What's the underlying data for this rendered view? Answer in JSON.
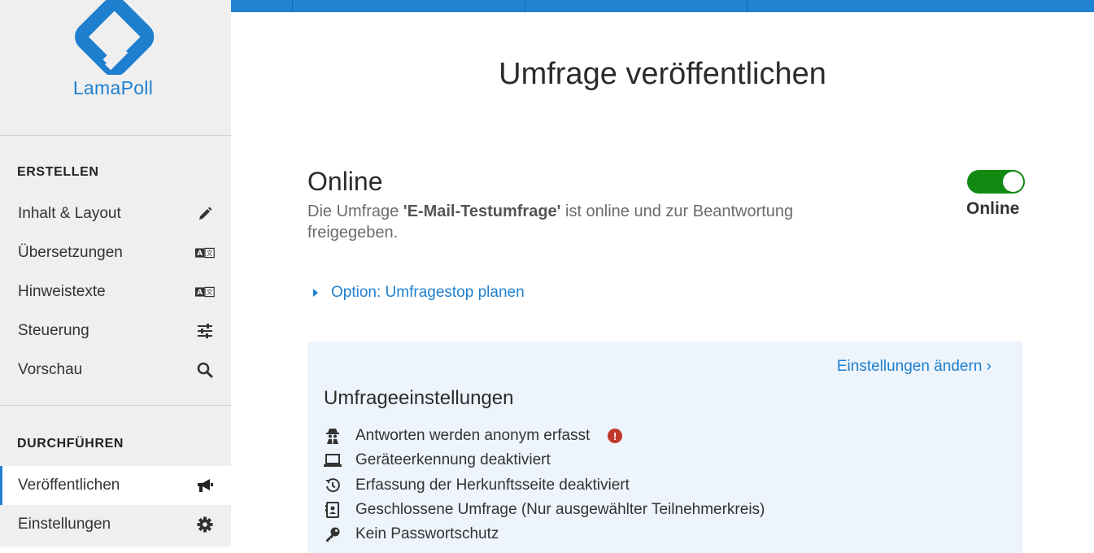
{
  "brand": {
    "name": "LamaPoll",
    "color": "#1f7fcf"
  },
  "sidebar": {
    "sections": [
      {
        "heading": "ERSTELLEN",
        "items": [
          {
            "label": "Inhalt & Layout",
            "icon": "pencil-icon"
          },
          {
            "label": "Übersetzungen",
            "icon": "translate-icon"
          },
          {
            "label": "Hinweistexte",
            "icon": "translate-icon"
          },
          {
            "label": "Steuerung",
            "icon": "sliders-icon"
          },
          {
            "label": "Vorschau",
            "icon": "search-icon"
          }
        ]
      },
      {
        "heading": "DURCHFÜHREN",
        "items": [
          {
            "label": "Veröffentlichen",
            "icon": "megaphone-icon",
            "active": true
          },
          {
            "label": "Einstellungen",
            "icon": "gear-icon"
          }
        ]
      }
    ]
  },
  "main": {
    "title": "Umfrage veröffentlichen",
    "status": {
      "heading": "Online",
      "desc_prefix": "Die Umfrage ",
      "survey_name": "'E-Mail-Testumfrage'",
      "desc_suffix": " ist online und zur Beantwortung freigegeben.",
      "toggle_on": true,
      "toggle_label": "Online",
      "toggle_color": "#128a12"
    },
    "option_link": "Option: Umfragestop planen",
    "settings": {
      "change_link": "Einstellungen ändern ›",
      "title": "Umfrageeinstellungen",
      "items": [
        {
          "text": "Antworten werden anonym erfasst",
          "icon": "spy-icon",
          "warning": true
        },
        {
          "text": "Geräteerkennung deaktiviert",
          "icon": "laptop-icon"
        },
        {
          "text": "Erfassung der Herkunftsseite deaktiviert",
          "icon": "history-icon"
        },
        {
          "text": "Geschlossene Umfrage (Nur ausgewählter Teilnehmerkreis)",
          "icon": "contact-card-icon"
        },
        {
          "text": "Kein Passwortschutz",
          "icon": "key-icon"
        }
      ]
    }
  }
}
